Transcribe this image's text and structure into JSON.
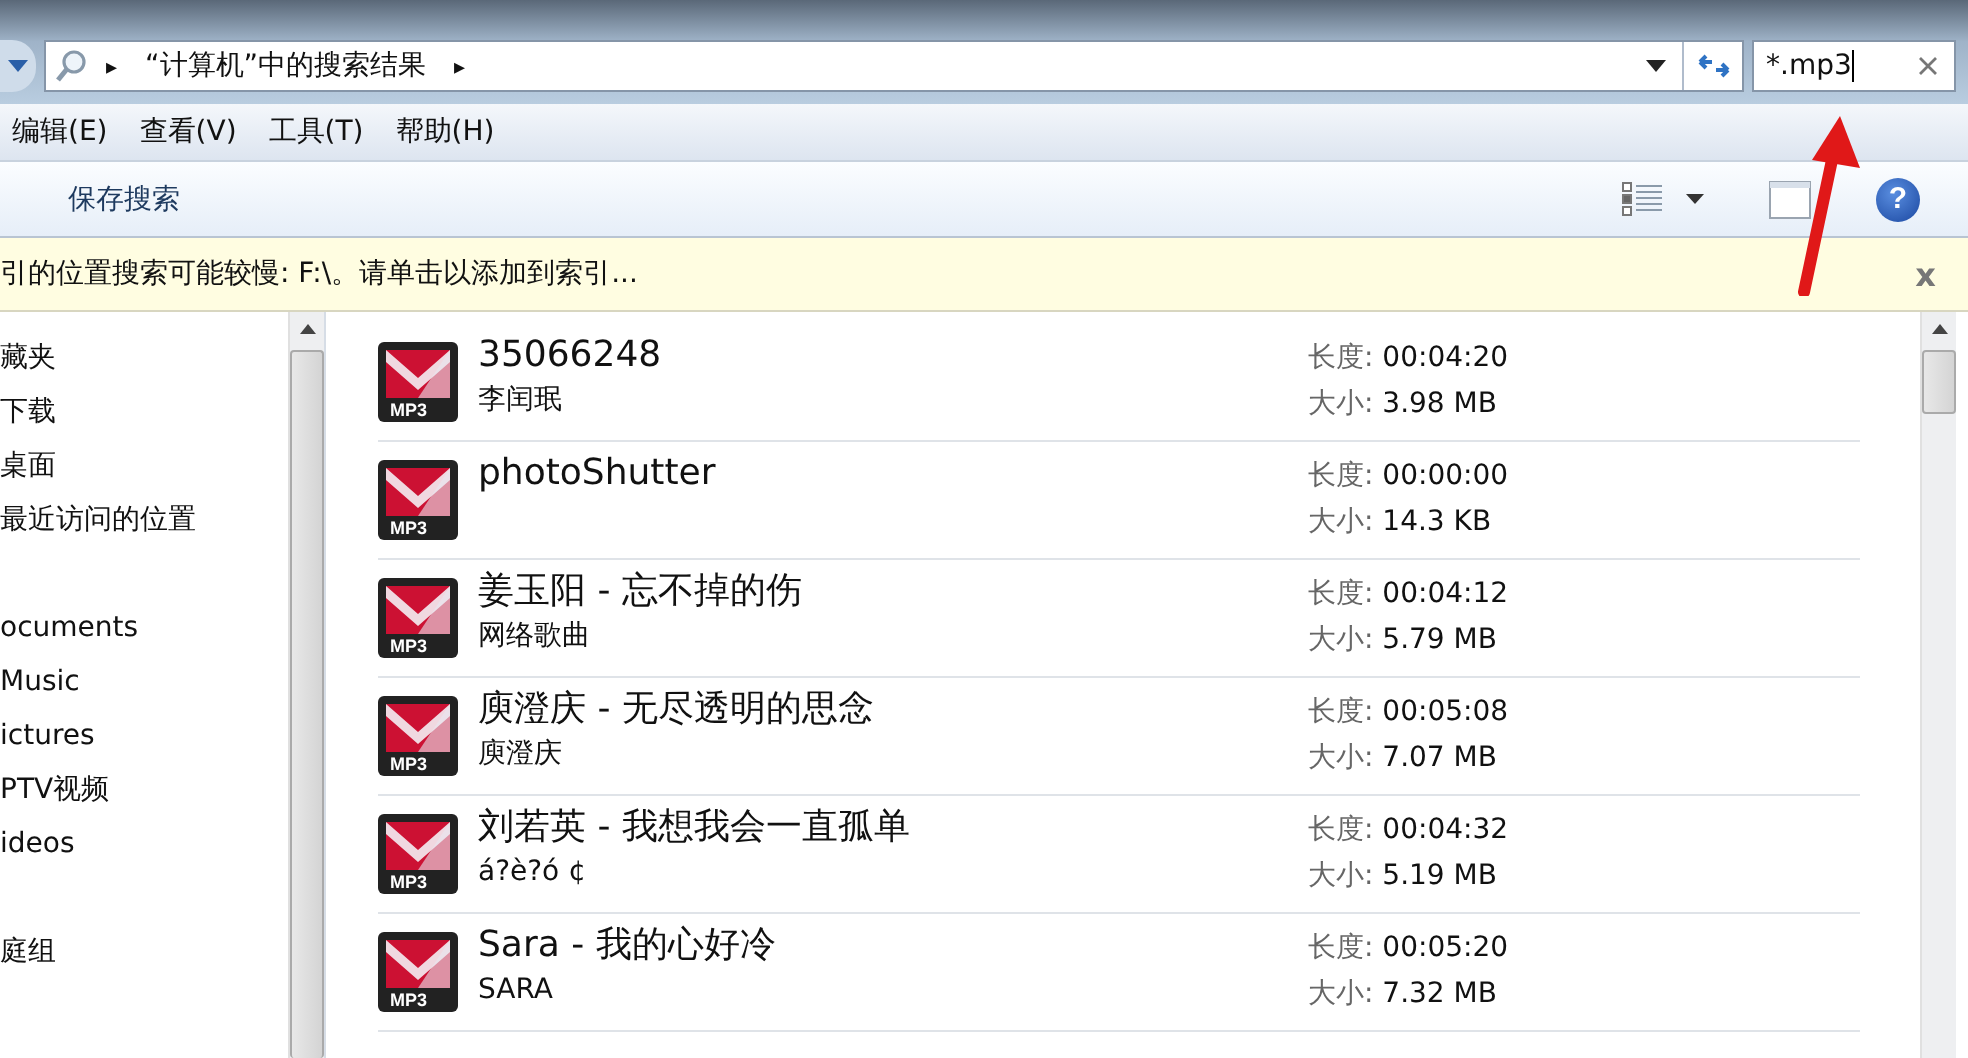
{
  "address_bar": {
    "separator_glyph": "▸",
    "breadcrumb": "“计算机”中的搜索结果",
    "search_value": "*.mp3"
  },
  "menu": [
    "编辑(E)",
    "查看(V)",
    "工具(T)",
    "帮助(H)"
  ],
  "toolbar": {
    "save_search": "保存搜索",
    "help_glyph": "?"
  },
  "info_bar": {
    "message": "引的位置搜索可能较慢: F:\\。请单击以添加到索引...",
    "close": "x"
  },
  "nav_groups": [
    {
      "items": [
        "藏夹",
        "下载",
        "桌面",
        "最近访问的位置"
      ]
    },
    {
      "items": [
        "ocuments",
        "Music",
        "ictures",
        "PTV视频",
        "ideos"
      ]
    },
    {
      "items": [
        "庭组"
      ]
    }
  ],
  "files": [
    {
      "badge": "MP3",
      "title": "35066248",
      "subtitle": "李闰珉",
      "length_label": "长度:",
      "length": "00:04:20",
      "size_label": "大小:",
      "size": "3.98 MB"
    },
    {
      "badge": "MP3",
      "title": "photoShutter",
      "length_label": "长度:",
      "length": "00:00:00",
      "size_label": "大小:",
      "size": "14.3 KB"
    },
    {
      "badge": "MP3",
      "title": "姜玉阳 - 忘不掉的伤",
      "subtitle": "网络歌曲",
      "length_label": "长度:",
      "length": "00:04:12",
      "size_label": "大小:",
      "size": "5.79 MB"
    },
    {
      "badge": "MP3",
      "title": "庾澄庆 - 无尽透明的思念",
      "subtitle": "庾澄庆",
      "length_label": "长度:",
      "length": "00:05:08",
      "size_label": "大小:",
      "size": "7.07 MB"
    },
    {
      "badge": "MP3",
      "title": "刘若英 - 我想我会一直孤单",
      "subtitle": "á?è?ó ¢",
      "length_label": "长度:",
      "length": "00:04:32",
      "size_label": "大小:",
      "size": "5.19 MB"
    },
    {
      "badge": "MP3",
      "title": "Sara - 我的心好冷",
      "subtitle": "SARA",
      "length_label": "长度:",
      "length": "00:05:20",
      "size_label": "大小:",
      "size": "7.32 MB"
    }
  ]
}
